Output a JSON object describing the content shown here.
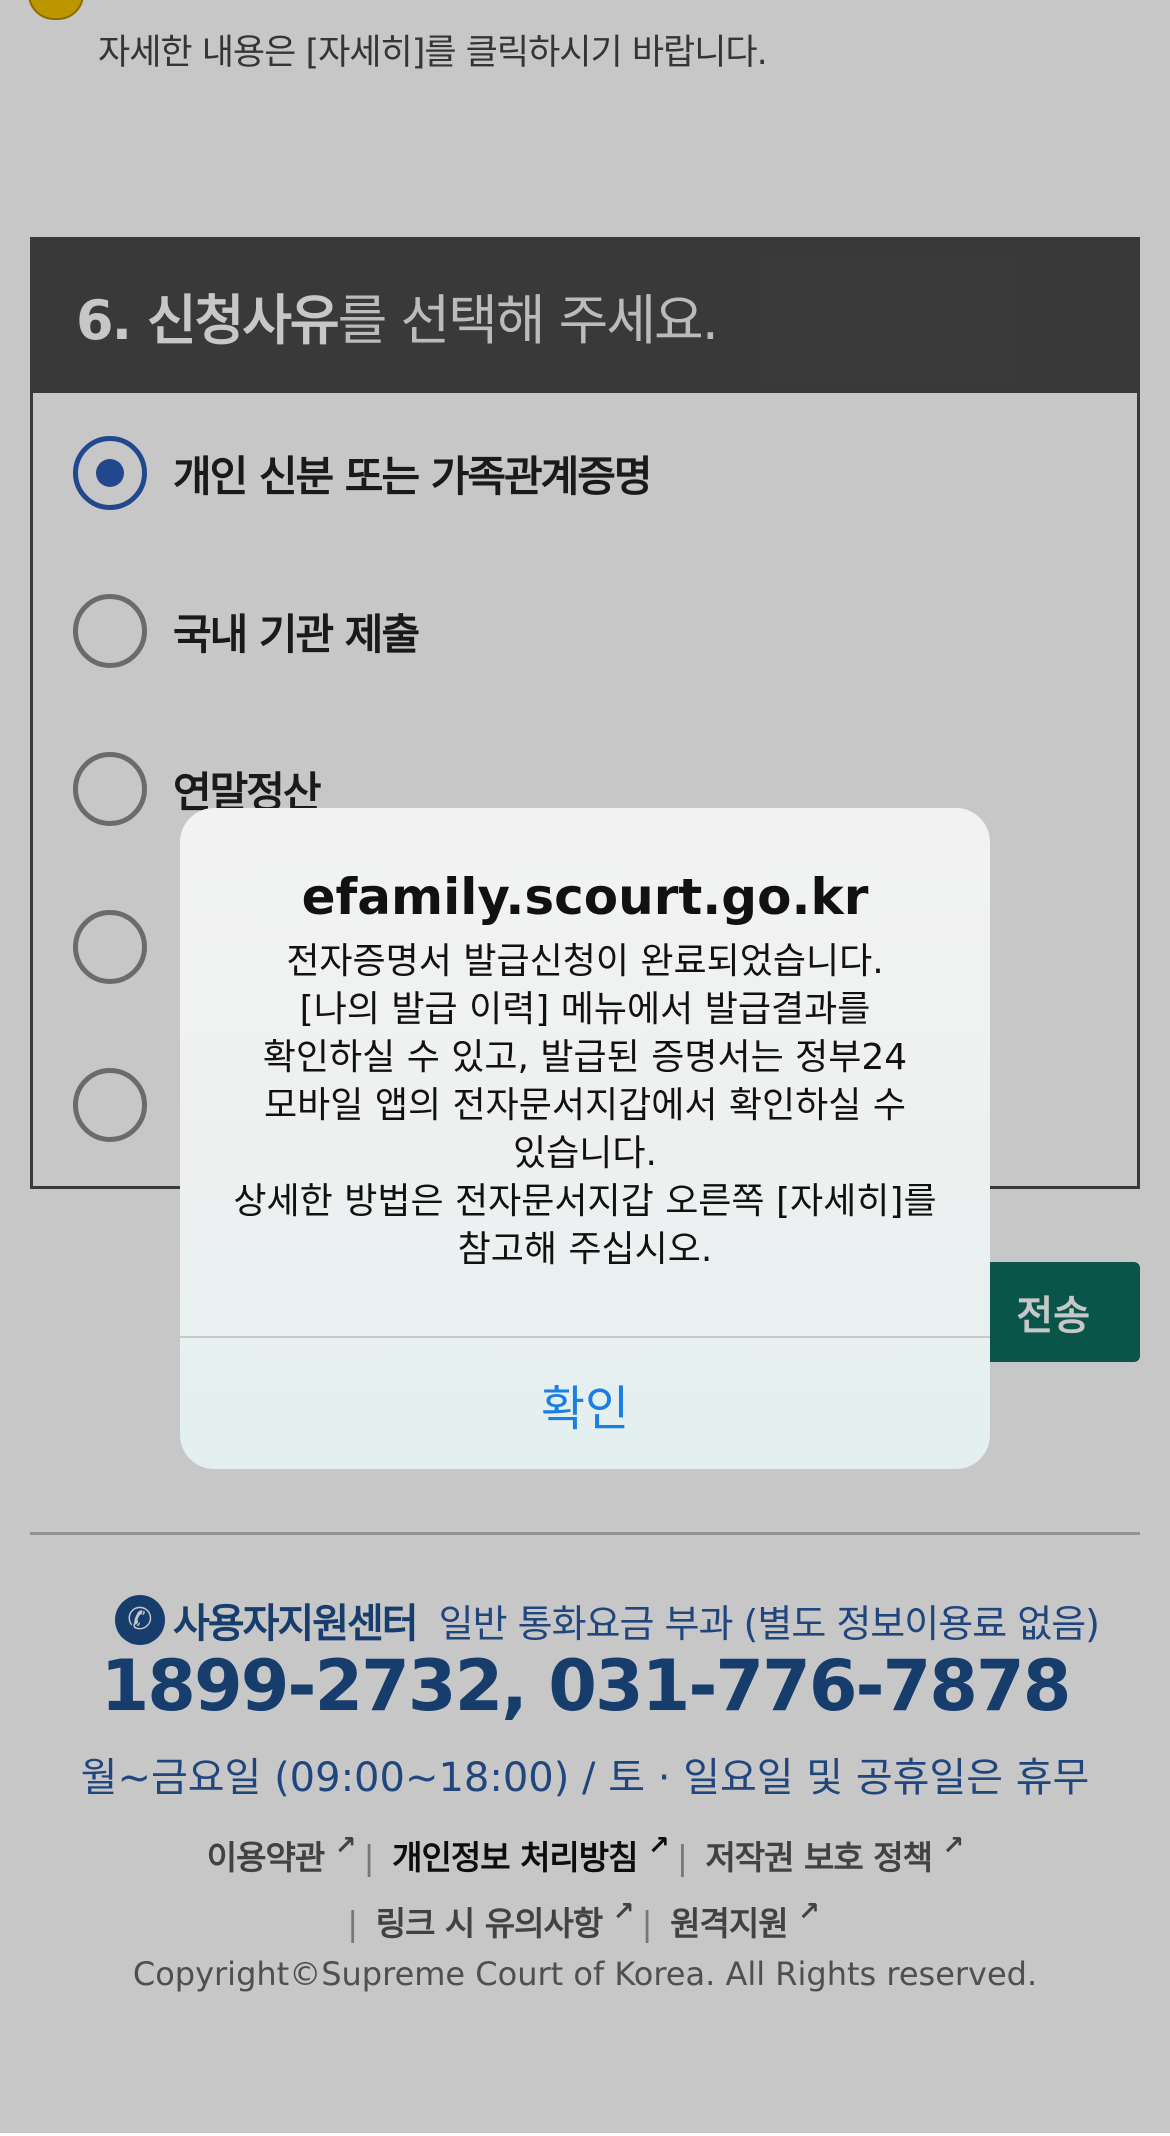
{
  "notice": {
    "text": "자세한 내용은 [자세히]를 클릭하시기 바랍니다."
  },
  "section6": {
    "heading_bold": "6. 신청사유",
    "heading_rest": "를 선택해 주세요.",
    "options": [
      {
        "label": "개인 신분 또는 가족관계증명",
        "checked": true
      },
      {
        "label": "국내 기관 제출",
        "checked": false
      },
      {
        "label": "연말정산",
        "checked": false
      },
      {
        "label": "",
        "checked": false
      },
      {
        "label": "",
        "checked": false
      }
    ]
  },
  "send_button": {
    "label": "전송"
  },
  "footer": {
    "support_title": "사용자지원센터",
    "support_note": "일반 통화요금 부과 (별도 정보이용료 없음)",
    "phone": "1899-2732, 031-776-7878",
    "hours": "월~금요일 (09:00~18:00) / 토 · 일요일 및 공휴일은 휴무",
    "links_row1": [
      "이용약관",
      "개인정보 처리방침",
      "저작권 보호 정책"
    ],
    "links_row2": [
      "링크 시 유의사항",
      "원격지원"
    ],
    "copyright": "Copyright©Supreme Court of Korea. All Rights reserved."
  },
  "dialog": {
    "title": "efamily.scourt.go.kr",
    "message": "전자증명서 발급신청이 완료되었습니다.\n[나의 발급 이력] 메뉴에서 발급결과를\n확인하실 수 있고, 발급된 증명서는 정부24\n모바일 앱의 전자문서지갑에서 확인하실 수\n있습니다.\n상세한 방법은 전자문서지갑 오른쪽 [자세히]를\n참고해 주십시오.",
    "confirm_label": "확인"
  },
  "icons": [
    "warning-icon",
    "phone-icon",
    "external-link-icon"
  ],
  "colors": {
    "accent_blue": "#2b5bb5",
    "footer_blue": "#1e4f8c",
    "send_green": "#0d6e5e",
    "dialog_link": "#1a7fe0"
  }
}
